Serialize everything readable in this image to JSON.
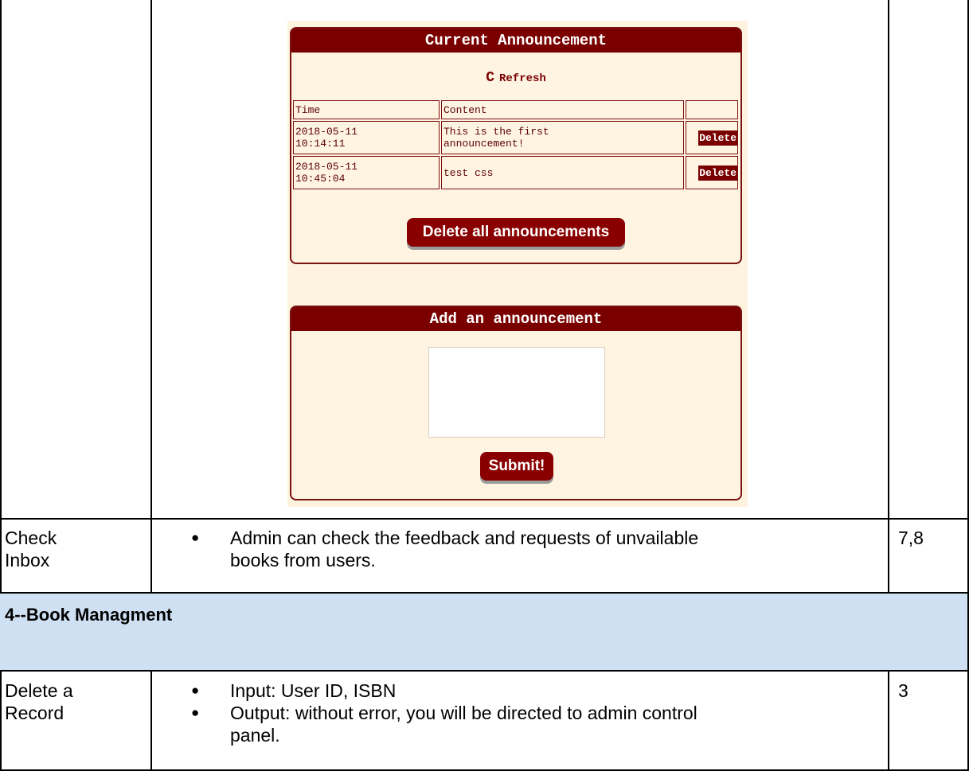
{
  "screenshot": {
    "current_panel": {
      "title": "Current Announcement",
      "refresh_icon": "refresh-icon",
      "refresh_label": "Refresh",
      "headers": [
        "Time",
        "Content",
        ""
      ],
      "rows": [
        {
          "time_date": "2018-05-11",
          "time_clock": "10:14:11",
          "content_line1": "This is the first",
          "content_line2": "announcement!",
          "action": "Delete"
        },
        {
          "time_date": "2018-05-11",
          "time_clock": "10:45:04",
          "content_line1": "test css",
          "content_line2": "",
          "action": "Delete"
        }
      ],
      "delete_all_label": "Delete all announcements"
    },
    "add_panel": {
      "title": "Add an announcement",
      "textarea_value": "",
      "submit_label": "Submit!"
    }
  },
  "rows": [
    {
      "feature_line1": "Check",
      "feature_line2": "Inbox",
      "bullets": [
        "Admin can check the feedback and requests of unvailable",
        "books from users."
      ],
      "ref": "7,8"
    },
    {
      "feature_line1": "Delete a",
      "feature_line2": "Record",
      "bullets": [
        "Input: User ID, ISBN",
        "Output: without error, you will be directed to admin control",
        "panel."
      ],
      "ref": "3"
    }
  ],
  "section": {
    "title": "4--Book Managment"
  },
  "colors": {
    "panel_header": "#7a0000",
    "panel_bg": "#fff4e2",
    "section_band": "#cfe0f3"
  }
}
